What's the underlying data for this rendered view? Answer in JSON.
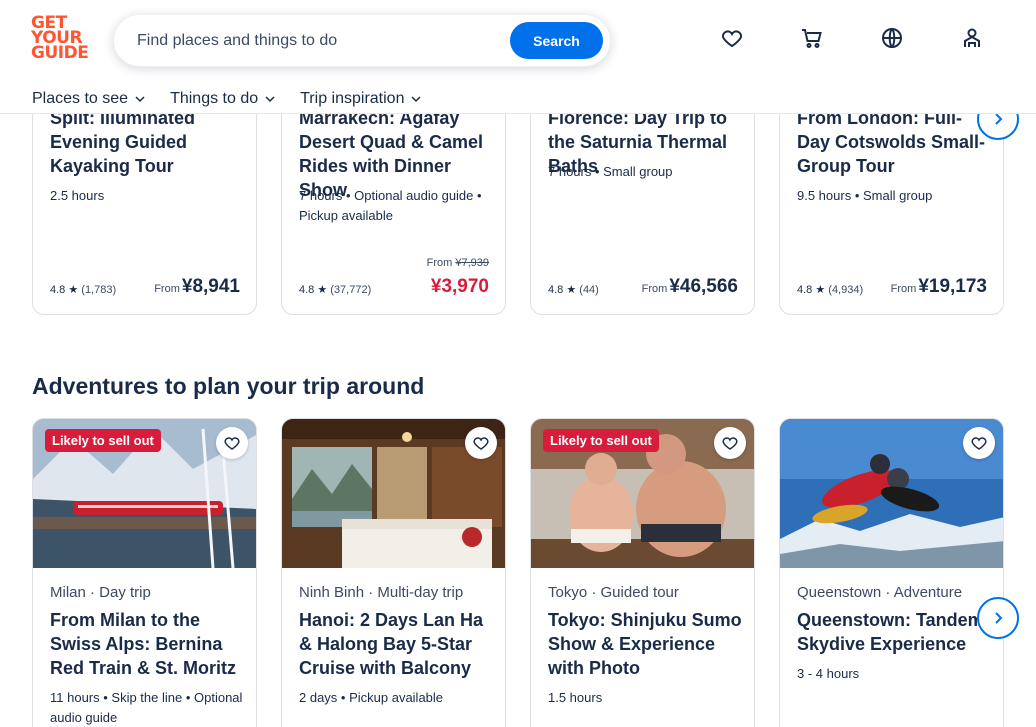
{
  "header": {
    "logo": [
      "GET",
      "YOUR",
      "GUIDE"
    ],
    "search_placeholder": "Find places and things to do",
    "search_button": "Search",
    "icons": [
      "heart-icon",
      "cart-icon",
      "globe-icon",
      "profile-icon"
    ]
  },
  "nav": [
    {
      "label": "Places to see"
    },
    {
      "label": "Things to do"
    },
    {
      "label": "Trip inspiration"
    }
  ],
  "top_cards": [
    {
      "title": "Split: Illuminated Evening Guided Kayaking Tour",
      "meta": "2.5 hours",
      "rating": "4.8",
      "count": "(1,783)",
      "from": "From",
      "price": "¥8,941"
    },
    {
      "title": "Marrakech: Agafay Desert Quad & Camel Rides with Dinner Show",
      "meta": "7 hours • Optional audio guide • Pickup available",
      "rating": "4.8",
      "count": "(37,772)",
      "from": "From",
      "original_price": "¥7,939",
      "price": "¥3,970"
    },
    {
      "title": "Florence: Day Trip to the Saturnia Thermal Baths",
      "meta": "7 hours • Small group",
      "rating": "4.8",
      "count": "(44)",
      "from": "From",
      "price": "¥46,566"
    },
    {
      "title": "From London: Full-Day Cotswolds Small-Group Tour",
      "meta": "9.5 hours • Small group",
      "rating": "4.8",
      "count": "(4,934)",
      "from": "From",
      "price": "¥19,173"
    }
  ],
  "section_title": "Adventures to plan your trip around",
  "adventure_cards": [
    {
      "badge": "Likely to sell out",
      "location": "Milan · Day trip",
      "title": "From Milan to the Swiss Alps: Bernina Red Train & St. Moritz",
      "meta": "11 hours • Skip the line • Optional audio guide"
    },
    {
      "badge": "",
      "location": "Ninh Binh · Multi-day trip",
      "title": "Hanoi: 2 Days Lan Ha & Halong Bay 5-Star Cruise with Balcony",
      "meta": "2 days • Pickup available"
    },
    {
      "badge": "Likely to sell out",
      "location": "Tokyo · Guided tour",
      "title": "Tokyo: Shinjuku Sumo Show & Experience with Photo",
      "meta": "1.5 hours"
    },
    {
      "badge": "",
      "location": "Queenstown · Adventure",
      "title": "Queenstown: Tandem Skydive Experience",
      "meta": "3 - 4 hours"
    }
  ],
  "colors": {
    "brand": "#ff5533",
    "primary": "#0071eb",
    "text": "#1a2b49",
    "sale": "#d61d3c"
  }
}
